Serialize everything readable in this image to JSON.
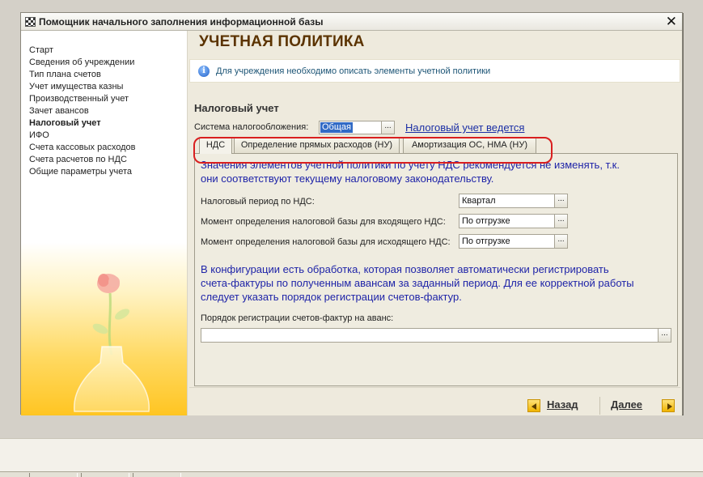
{
  "window": {
    "title": "Помощник начального заполнения информационной базы",
    "close_label": "✕"
  },
  "sidebar": {
    "items": [
      {
        "label": "Старт"
      },
      {
        "label": "Сведения об учреждении"
      },
      {
        "label": "Тип плана счетов"
      },
      {
        "label": "Учет имущества казны"
      },
      {
        "label": "Производственный учет"
      },
      {
        "label": "Зачет авансов"
      },
      {
        "label": "Налоговый учет"
      },
      {
        "label": "ИФО"
      },
      {
        "label": "Счета кассовых расходов"
      },
      {
        "label": "Счета расчетов по НДС"
      },
      {
        "label": "Общие параметры учета"
      }
    ],
    "active_index": 6
  },
  "main": {
    "title": "УЧЕТНАЯ ПОЛИТИКА",
    "info": "Для учреждения необходимо описать элементы учетной политики",
    "section_title": "Налоговый учет",
    "tax_system_label": "Система налогообложения:",
    "tax_system_value": "Общая",
    "tax_link": "Налоговый учет ведется",
    "tabs": [
      {
        "label": "НДС"
      },
      {
        "label": "Определение прямых расходов (НУ)"
      },
      {
        "label": "Амортизация ОС, НМА (НУ)"
      }
    ],
    "active_tab": 0,
    "vat": {
      "note_line1": "Значения элементов учетной политики по учету НДС рекомендуется не изменять, т.к.",
      "note_line2": "они соответствуют текущему налоговому законодательству.",
      "fields": [
        {
          "label": "Налоговый период по НДС:",
          "value": "Квартал"
        },
        {
          "label": "Момент определения налоговой базы для входящего НДС:",
          "value": "По отгрузке"
        },
        {
          "label": "Момент определения налоговой базы для исходящего НДС:",
          "value": "По отгрузке"
        }
      ],
      "processing_line1": "В конфигурации есть обработка, которая позволяет автоматически регистрировать",
      "processing_line2": "счета-фактуры по полученным авансам за заданный период. Для ее корректной работы",
      "processing_line3": "следует указать порядок регистрации счетов-фактур.",
      "invoice_order_label": "Порядок регистрации счетов-фактур на аванс:",
      "invoice_order_value": ""
    },
    "footer": {
      "back_label": "Назад",
      "next_label": "Далее"
    },
    "select_button_label": "..."
  },
  "colors": {
    "accent_title": "#5b3300",
    "note_blue": "#1f24a8",
    "highlight_red": "#d91f1f",
    "selection": "#316ac5"
  }
}
